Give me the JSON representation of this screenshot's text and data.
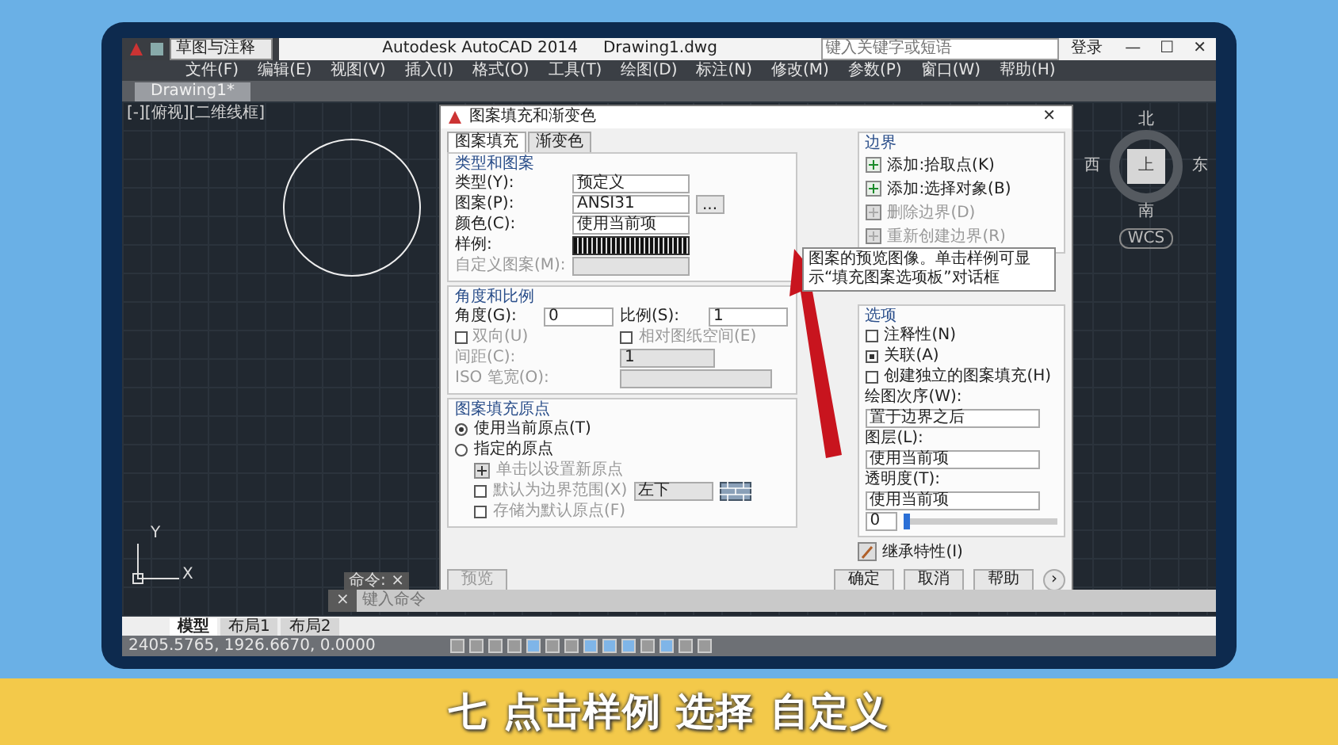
{
  "titlebar": {
    "workspace": "草图与注释",
    "title": "Autodesk AutoCAD 2014",
    "file": "Drawing1.dwg",
    "search": {
      "placeholder": "键入关键字或短语"
    },
    "signin": "登录",
    "controls": [
      "—",
      "☐",
      "✕"
    ]
  },
  "menus": [
    "文件(F)",
    "编辑(E)",
    "视图(V)",
    "插入(I)",
    "格式(O)",
    "工具(T)",
    "绘图(D)",
    "标注(N)",
    "修改(M)",
    "参数(P)",
    "窗口(W)",
    "帮助(H)"
  ],
  "doc_tabs": [
    {
      "label": "Drawing1*",
      "selected": true
    }
  ],
  "viewport_label": "[-][俯视][二维线框]",
  "viewcube": {
    "north": "北",
    "west": "西",
    "top": "上",
    "east": "东",
    "south": "南",
    "wcs": "WCS"
  },
  "ucs": {
    "y": "Y",
    "x": "X"
  },
  "dialog": {
    "title": "图案填充和渐变色",
    "close": "✕",
    "tabs": [
      {
        "label": "图案填充",
        "selected": true
      },
      {
        "label": "渐变色",
        "selected": false
      }
    ],
    "pattern_group": {
      "title": "类型和图案",
      "type_label": "类型(Y):",
      "type": "预定义",
      "pattern_label": "图案(P):",
      "pattern": "ANSI31",
      "more": "...",
      "color_label": "颜色(C):",
      "color_option": "使用当前项",
      "sample_label": "样例:",
      "custom_label": "自定义图案(M):"
    },
    "angle_group": {
      "title": "角度和比例",
      "angle_label": "角度(G):",
      "angle": "0",
      "scale_label": "比例(S):",
      "scale": "1",
      "double": {
        "label": "双向(U)",
        "checked": false
      },
      "relative": {
        "label": "相对图纸空间(E)",
        "checked": false
      },
      "spacing_label": "间距(C):",
      "spacing": "1",
      "iso_label": "ISO 笔宽(O):"
    },
    "origin_group": {
      "title": "图案填充原点",
      "options": [
        {
          "label": "使用当前原点(T)",
          "selected": true
        },
        {
          "label": "指定的原点",
          "selected": false
        }
      ],
      "click_label": "单击以设置新原点",
      "default_extent": {
        "label": "默认为边界范围(X)",
        "checked": false
      },
      "position": "左下",
      "store": {
        "label": "存储为默认原点(F)",
        "checked": false
      }
    },
    "boundary_group": {
      "title": "边界",
      "actions": [
        {
          "label": "添加:拾取点(K)",
          "disabled": false
        },
        {
          "label": "添加:选择对象(B)",
          "disabled": false
        },
        {
          "label": "删除边界(D)",
          "disabled": true
        },
        {
          "label": "重新创建边界(R)",
          "disabled": true
        }
      ]
    },
    "options_group": {
      "title": "选项",
      "checks": [
        {
          "label": "注释性(N)",
          "checked": false
        },
        {
          "label": "关联(A)",
          "checked": true
        },
        {
          "label": "创建独立的图案填充(H)",
          "checked": false
        }
      ],
      "order_label": "绘图次序(W):",
      "order": "置于边界之后",
      "layer_label": "图层(L):",
      "layer": "使用当前项",
      "transparency_label": "透明度(T):",
      "transparency": "使用当前项",
      "transparency_value": "0",
      "transparency_slider": {
        "level": 0
      }
    },
    "inherit": "继承特性(I)",
    "tooltip": "图案的预览图像。单击样例可显示“填充图案选项板”对话框",
    "buttons": [
      {
        "label": "预览",
        "disabled": true
      },
      {
        "label": "确定",
        "disabled": false
      },
      {
        "label": "取消",
        "disabled": false
      },
      {
        "label": "帮助",
        "disabled": false
      }
    ],
    "more": "›"
  },
  "command": {
    "title": "命令:",
    "close": "×",
    "placeholder": "键入命令"
  },
  "layout_tabs": [
    {
      "label": "模型",
      "selected": true
    },
    {
      "label": "布局1",
      "selected": false
    },
    {
      "label": "布局2",
      "selected": false
    }
  ],
  "status": {
    "coords": "2405.5765, 1926.6670, 0.0000"
  },
  "caption": "七 点击样例 选择 自定义"
}
